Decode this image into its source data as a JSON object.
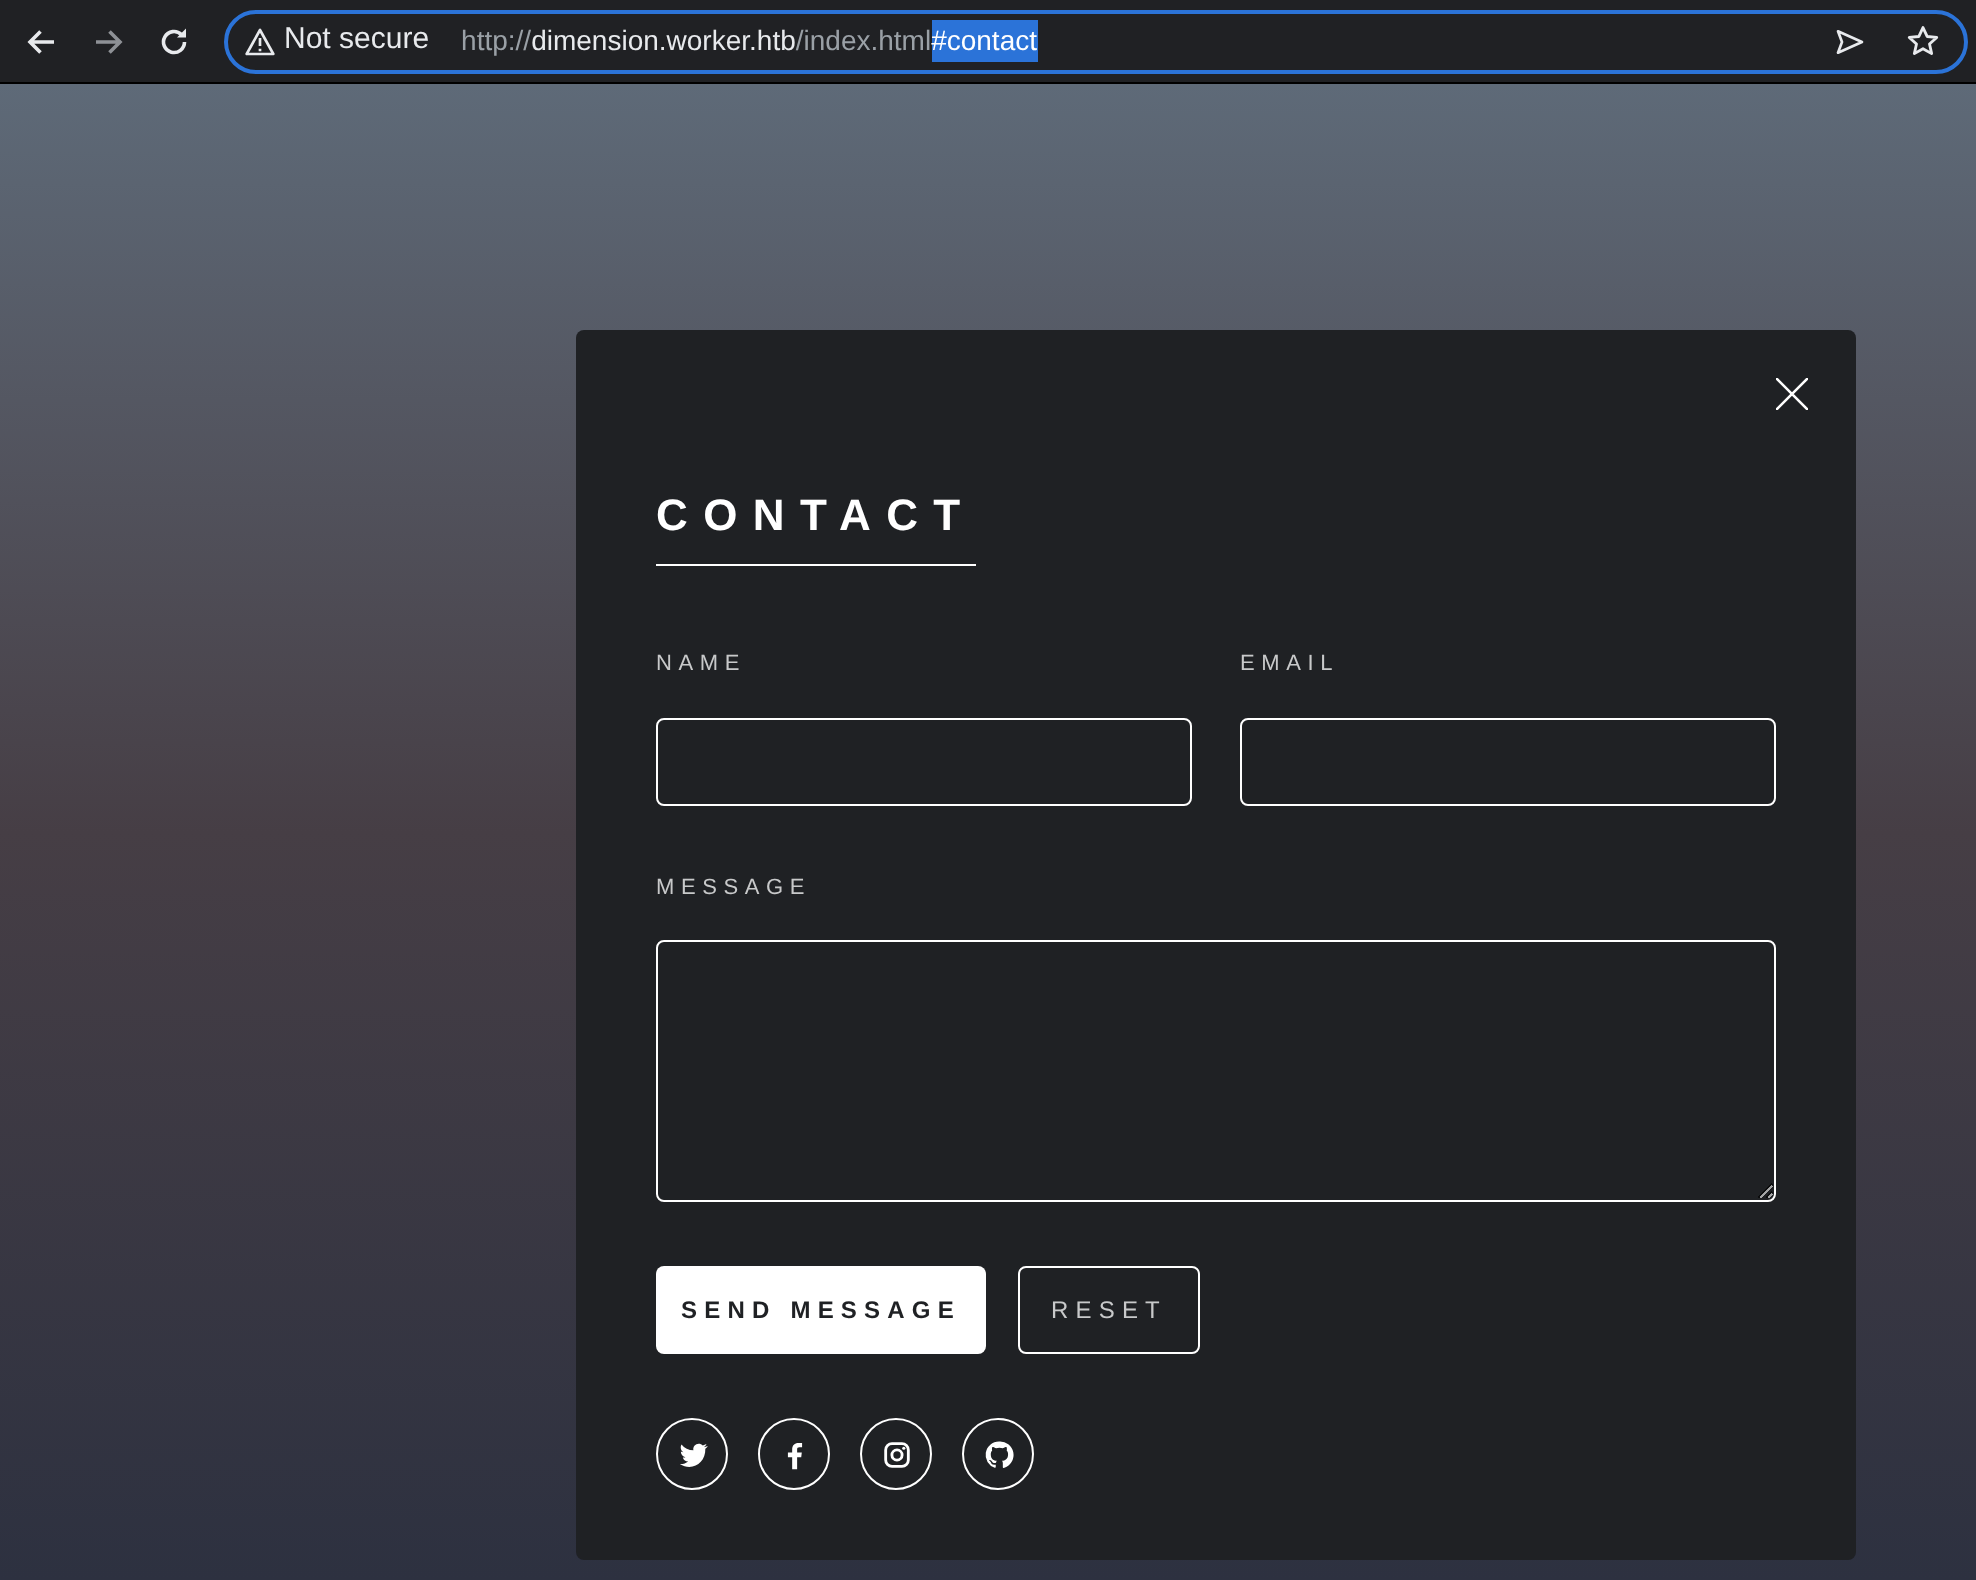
{
  "browser": {
    "security_label": "Not secure",
    "url": [
      {
        "kind": "scheme",
        "text": "http://"
      },
      {
        "kind": "host",
        "text": "dimension.worker.htb"
      },
      {
        "kind": "path",
        "text": "/index.html"
      },
      {
        "kind": "selected",
        "text": "#contact"
      }
    ]
  },
  "modal": {
    "title": "CONTACT",
    "fields": [
      {
        "kind": "input",
        "label": "NAME"
      },
      {
        "kind": "input",
        "label": "EMAIL"
      },
      {
        "kind": "textarea",
        "label": "MESSAGE"
      }
    ],
    "buttons": [
      {
        "kind": "primary",
        "label": "SEND MESSAGE"
      },
      {
        "kind": "secondary",
        "label": "RESET"
      }
    ],
    "social": [
      {
        "kind": "twitter"
      },
      {
        "kind": "facebook"
      },
      {
        "kind": "instagram"
      },
      {
        "kind": "github"
      }
    ]
  }
}
